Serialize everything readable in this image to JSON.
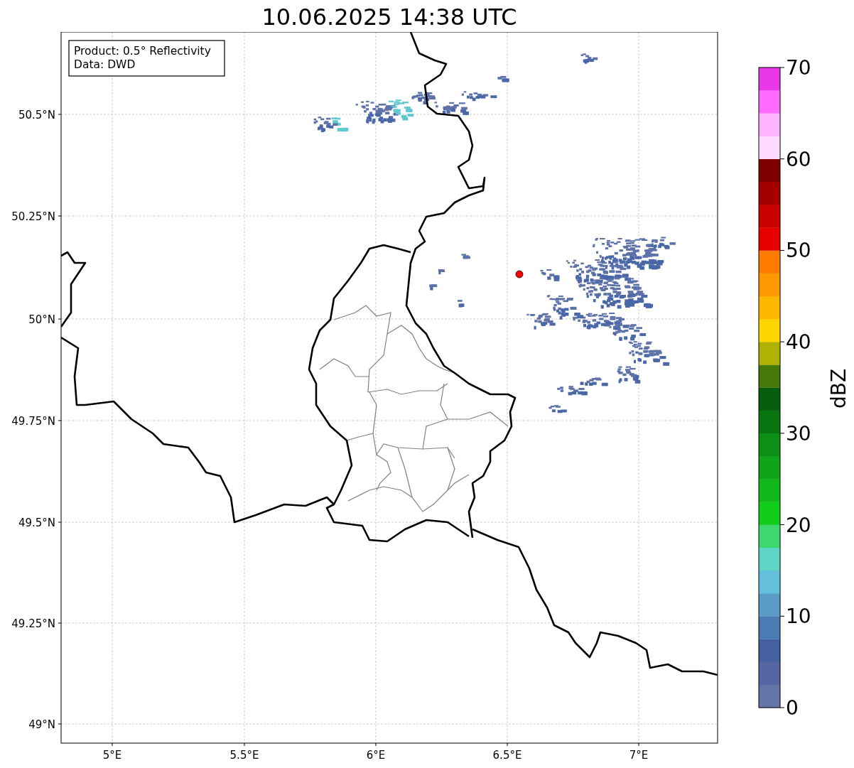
{
  "title": "10.06.2025 14:38 UTC",
  "info_box": [
    "Product: 0.5° Reflectivity",
    "Data: DWD"
  ],
  "lon_ticks": [
    "5°E",
    "5.5°E",
    "6°E",
    "6.5°E",
    "7°E"
  ],
  "lat_ticks": [
    "50.5°N",
    "50.25°N",
    "50°N",
    "49.75°N",
    "49.5°N",
    "49.25°N",
    "49°N"
  ],
  "colorbar": {
    "label": "dBZ",
    "ticks": [
      "70",
      "60",
      "50",
      "40",
      "30",
      "20",
      "10",
      "0"
    ],
    "bins": [
      {
        "color": "#6574a6"
      },
      {
        "color": "#5467a3"
      },
      {
        "color": "#4460a3"
      },
      {
        "color": "#4a7bb3"
      },
      {
        "color": "#5b9cc6"
      },
      {
        "color": "#64c0dc"
      },
      {
        "color": "#5fd6c5"
      },
      {
        "color": "#3ed66f"
      },
      {
        "color": "#12cc1c"
      },
      {
        "color": "#10b81b"
      },
      {
        "color": "#0ea518"
      },
      {
        "color": "#0c8f15"
      },
      {
        "color": "#0a7612"
      },
      {
        "color": "#075e0e"
      },
      {
        "color": "#47780a"
      },
      {
        "color": "#b0b203"
      },
      {
        "color": "#ffd500"
      },
      {
        "color": "#ffb700"
      },
      {
        "color": "#ff9800"
      },
      {
        "color": "#ff7c00"
      },
      {
        "color": "#e60000"
      },
      {
        "color": "#c80000"
      },
      {
        "color": "#a50000"
      },
      {
        "color": "#7e0000"
      },
      {
        "color": "#ffdcff"
      },
      {
        "color": "#ffb4ff"
      },
      {
        "color": "#ff6cff"
      },
      {
        "color": "#e838ea"
      }
    ]
  }
}
